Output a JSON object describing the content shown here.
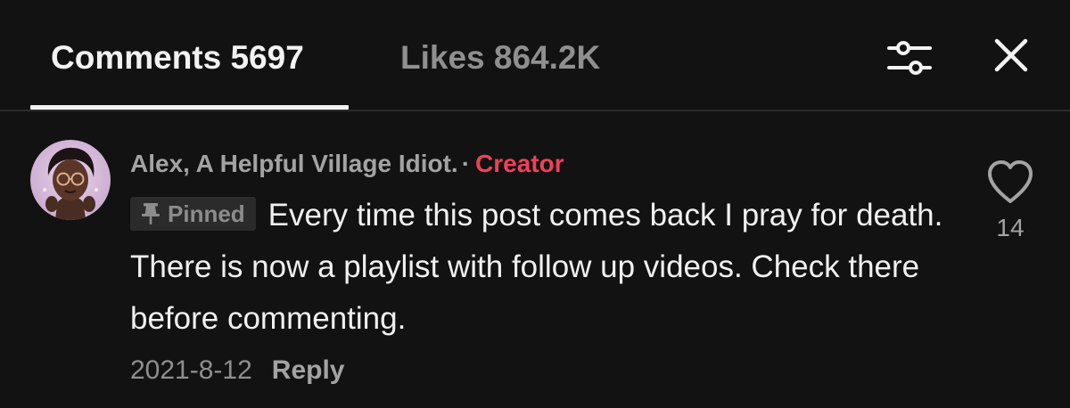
{
  "colors": {
    "background": "#121212",
    "text_primary": "#f2f2f2",
    "text_secondary": "#a3a3a3",
    "creator_accent": "#ee4159",
    "badge_background": "#2b2b2b"
  },
  "header": {
    "tabs": [
      {
        "label": "Comments 5697",
        "active": true
      },
      {
        "label": "Likes 864.2K",
        "active": false
      }
    ],
    "icons": [
      "filter-icon",
      "close-icon"
    ]
  },
  "comment": {
    "author": "Alex, A Helpful Village Idiot.",
    "separator": "·",
    "badge": "Creator",
    "pinned_label": "Pinned",
    "pin_icon": "pin-icon",
    "text": "Every time this post comes back I pray for death. There is now a playlist with follow up videos. Check there before commenting.",
    "date": "2021-8-12",
    "reply_label": "Reply",
    "like_icon": "heart-outline-icon",
    "like_count": "14"
  }
}
